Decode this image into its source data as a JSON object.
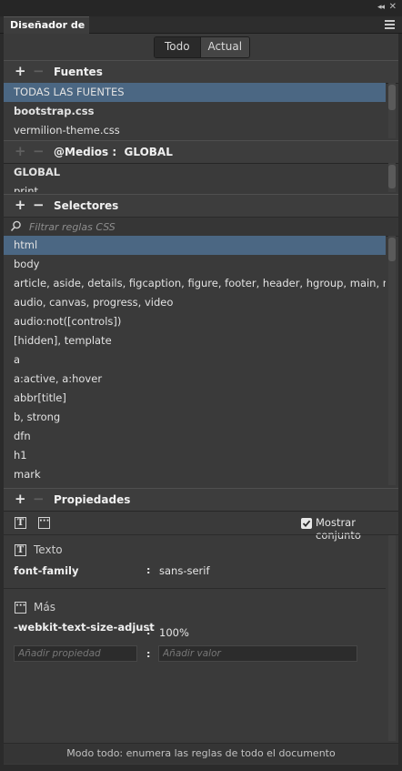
{
  "panel": {
    "title": "Diseñador de CSS"
  },
  "toggle": {
    "all": "Todo",
    "current": "Actual"
  },
  "sources": {
    "title": "Fuentes",
    "items": [
      "TODAS LAS FUENTES",
      "bootstrap.css",
      "vermilion-theme.css"
    ]
  },
  "media": {
    "title": "@Medios :",
    "scope": "GLOBAL",
    "items": [
      "GLOBAL",
      "print"
    ]
  },
  "selectors": {
    "title": "Selectores",
    "filter_placeholder": "Filtrar reglas CSS",
    "items": [
      "html",
      "body",
      "article, aside, details, figcaption, figure, footer, header, hgroup, main, menu,...",
      "audio, canvas, progress, video",
      "audio:not([controls])",
      "[hidden], template",
      "a",
      "a:active, a:hover",
      "abbr[title]",
      "b, strong",
      "dfn",
      "h1",
      "mark"
    ]
  },
  "properties": {
    "title": "Propiedades",
    "show_set_label": "Mostrar conjunto",
    "text_category": "Texto",
    "more_category": "Más",
    "font_family": {
      "name": "font-family",
      "value": "sans-serif"
    },
    "text_size_adjust": {
      "name": "-webkit-text-size-adjust",
      "value": "100%"
    },
    "add_property_placeholder": "Añadir propiedad",
    "add_value_placeholder": "Añadir valor",
    "separator": ":"
  },
  "footer": {
    "text": "Modo todo: enumera las reglas de todo el documento"
  },
  "icons": {
    "collapse": "double-chevron-left-icon",
    "close": "close-icon",
    "menu": "panel-menu-icon",
    "search": "search-icon",
    "text": "text-category-icon",
    "more": "more-category-icon"
  },
  "colors": {
    "selected_row": "#4b6783",
    "panel_bg": "#3a3a3a"
  }
}
